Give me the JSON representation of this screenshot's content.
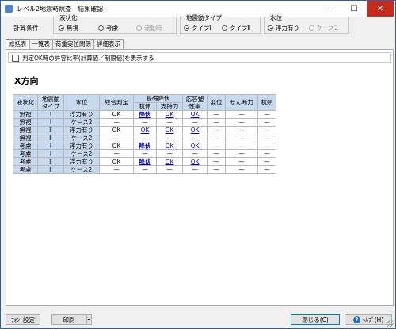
{
  "window": {
    "title": "レベル2地震時照査　結果確認"
  },
  "controls": {
    "minimize": "—",
    "maximize": "☐",
    "close": "✕"
  },
  "conditions": {
    "label": "計算条件",
    "liquefaction": {
      "title": "液状化",
      "options": [
        "無視",
        "考慮",
        "流動時"
      ],
      "selected": "無視"
    },
    "seismic": {
      "title": "地震動タイプ",
      "options": [
        "タイプⅠ",
        "タイプⅡ"
      ],
      "selected": "タイプⅠ"
    },
    "water": {
      "title": "水位",
      "options": [
        "浮力有り",
        "ケース2"
      ],
      "selected": "浮力有り"
    }
  },
  "tabs": [
    "総括表",
    "一覧表",
    "荷重実位関係",
    "詳細表示"
  ],
  "active_tab": "総括表",
  "checkbox_label": "判定OK時の許容比率(計算値／制限値)を表示する",
  "checkbox_checked": false,
  "direction_title": "X方向",
  "table": {
    "headers": {
      "liq": "液状化",
      "seis": "地震動タイプ",
      "water": "水位",
      "total": "総合判定",
      "found": "基礎降伏",
      "pile": "杭体",
      "support": "支持力",
      "resp": "応答塑性率",
      "disp": "変位",
      "shear": "せん断力",
      "head": "杭頭"
    },
    "rows": [
      {
        "liq": "無視",
        "seis": "Ⅰ",
        "water": "浮力有り",
        "total": "OK",
        "pile": "降伏",
        "support": "OK",
        "resp": "OK",
        "disp": "—",
        "shear": "—",
        "head": "—"
      },
      {
        "liq": "無視",
        "seis": "Ⅰ",
        "water": "ケース2",
        "total": "—",
        "pile": "—",
        "support": "—",
        "resp": "—",
        "disp": "—",
        "shear": "—",
        "head": "—"
      },
      {
        "liq": "無視",
        "seis": "Ⅱ",
        "water": "浮力有り",
        "total": "OK",
        "pile": "OK",
        "support": "OK",
        "resp": "OK",
        "disp": "—",
        "shear": "—",
        "head": "—"
      },
      {
        "liq": "無視",
        "seis": "Ⅱ",
        "water": "ケース2",
        "total": "—",
        "pile": "—",
        "support": "—",
        "resp": "—",
        "disp": "—",
        "shear": "—",
        "head": "—"
      },
      {
        "liq": "考慮",
        "seis": "Ⅰ",
        "water": "浮力有り",
        "total": "OK",
        "pile": "降伏",
        "support": "OK",
        "resp": "OK",
        "disp": "—",
        "shear": "—",
        "head": "—"
      },
      {
        "liq": "考慮",
        "seis": "Ⅰ",
        "water": "ケース2",
        "total": "—",
        "pile": "—",
        "support": "—",
        "resp": "—",
        "disp": "—",
        "shear": "—",
        "head": "—"
      },
      {
        "liq": "考慮",
        "seis": "Ⅱ",
        "water": "浮力有り",
        "total": "OK",
        "pile": "降伏",
        "support": "OK",
        "resp": "OK",
        "disp": "—",
        "shear": "—",
        "head": "—"
      },
      {
        "liq": "考慮",
        "seis": "Ⅱ",
        "water": "ケース2",
        "total": "—",
        "pile": "—",
        "support": "—",
        "resp": "—",
        "disp": "—",
        "shear": "—",
        "head": "—"
      }
    ]
  },
  "buttons": {
    "font": "ﾌｫﾝﾄ設定",
    "print": "印刷",
    "print_arrow": "▾",
    "close": "閉じる(C)",
    "help": "ﾍﾙﾌﾟ(H)",
    "help_icon": "?"
  }
}
